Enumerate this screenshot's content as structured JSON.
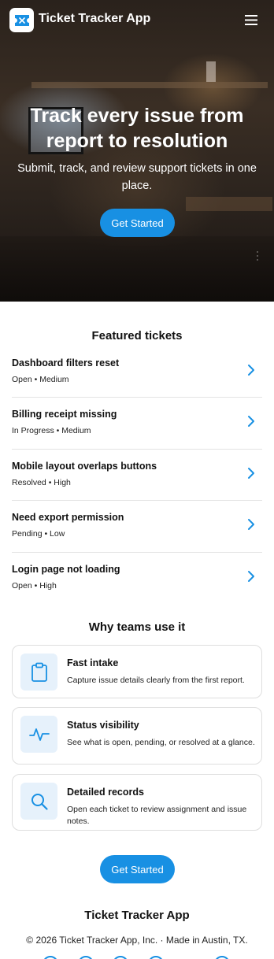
{
  "header": {
    "app_title": "Ticket Tracker App",
    "logo_icon": "ticket-icon",
    "menu_icon": "hamburger-menu-icon"
  },
  "hero": {
    "title": "Track every issue from report to resolution",
    "subtitle": "Submit, track, and review support tickets in one place.",
    "cta_label": "Get Started"
  },
  "featured": {
    "title": "Featured tickets",
    "tickets": [
      {
        "name": "Dashboard filters reset",
        "meta": "Open • Medium"
      },
      {
        "name": "Billing receipt missing",
        "meta": "In Progress • Medium"
      },
      {
        "name": "Mobile layout overlaps buttons",
        "meta": "Resolved • High"
      },
      {
        "name": "Need export permission",
        "meta": "Pending • Low"
      },
      {
        "name": "Login page not loading",
        "meta": "Open • High"
      }
    ]
  },
  "why": {
    "title": "Why teams use it",
    "features": [
      {
        "title": "Fast intake",
        "desc": "Capture issue details clearly from the first report.",
        "icon": "clipboard-icon"
      },
      {
        "title": "Status visibility",
        "desc": "See what is open, pending, or resolved at a glance.",
        "icon": "activity-icon"
      },
      {
        "title": "Detailed records",
        "desc": "Open each ticket to review assignment and issue notes.",
        "icon": "search-icon"
      }
    ]
  },
  "cta": {
    "label": "Get Started"
  },
  "footer": {
    "title": "Ticket Tracker App",
    "copyright": "© 2026 Ticket Tracker App, Inc. · Made in Austin, TX."
  },
  "colors": {
    "accent": "#1890e3",
    "icon_bg": "#e6f1fb"
  }
}
